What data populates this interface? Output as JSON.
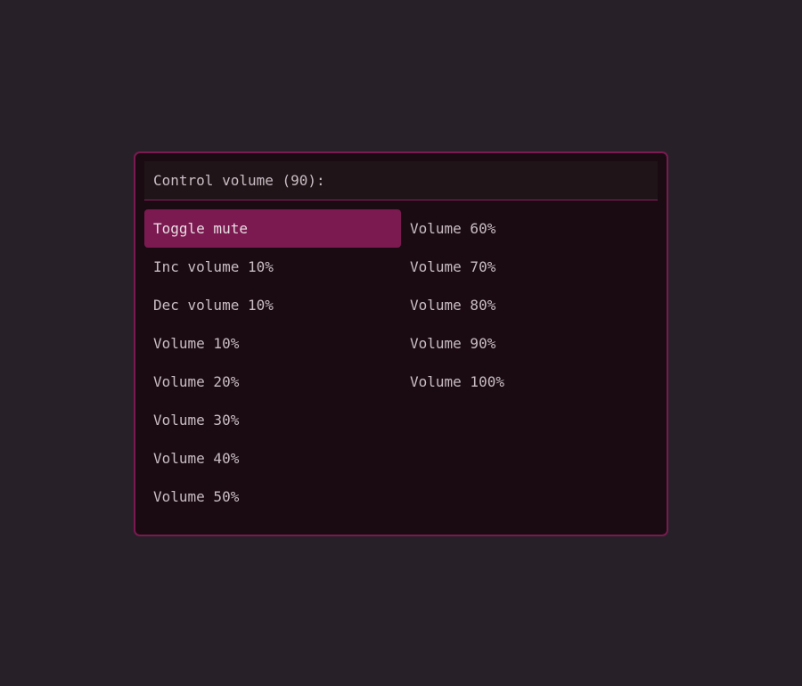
{
  "prompt": {
    "label": "Control volume (90):"
  },
  "items_column1": [
    "Toggle mute",
    "Inc volume 10%",
    "Dec volume 10%",
    "Volume 10%",
    "Volume 20%",
    "Volume 30%",
    "Volume 40%",
    "Volume 50%"
  ],
  "items_column2": [
    "Volume 60%",
    "Volume 70%",
    "Volume 80%",
    "Volume 90%",
    "Volume 100%"
  ],
  "selected_item": "Toggle mute",
  "colors": {
    "background": "#282028",
    "panel": "#1a0b12",
    "accent": "#7a1a50",
    "text": "#c9bdc3"
  }
}
